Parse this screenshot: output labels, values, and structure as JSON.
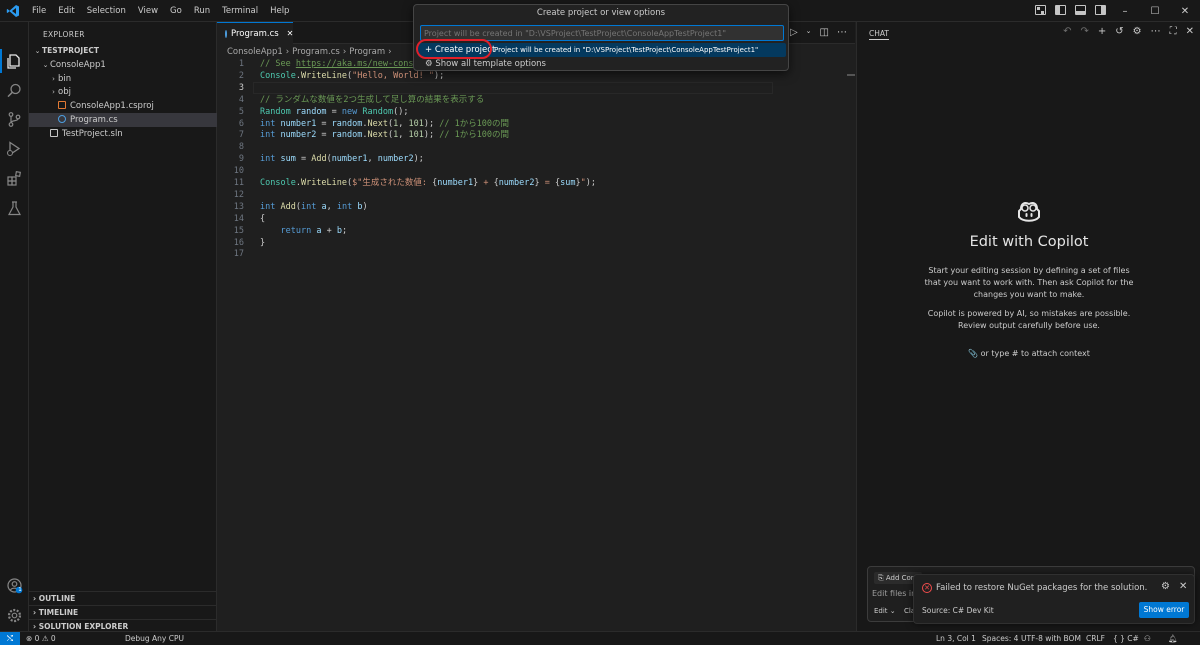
{
  "menu": [
    "File",
    "Edit",
    "Selection",
    "View",
    "Go",
    "Run",
    "Terminal",
    "Help"
  ],
  "window": {
    "minimize": "–",
    "maximize": "☐",
    "close": "✕"
  },
  "sidebar": {
    "title": "EXPLORER",
    "tree": [
      {
        "label": "TESTPROJECT",
        "indent": 0,
        "chevron": "⌄",
        "bold": true
      },
      {
        "label": "ConsoleApp1",
        "indent": 1,
        "chevron": "⌄"
      },
      {
        "label": "bin",
        "indent": 2,
        "chevron": "›"
      },
      {
        "label": "obj",
        "indent": 2,
        "chevron": "›"
      },
      {
        "label": "ConsoleApp1.csproj",
        "indent": 2,
        "chevron": "",
        "icon": "csproj-file-icon",
        "icon_color": "#e37933"
      },
      {
        "label": "Program.cs",
        "indent": 2,
        "chevron": "",
        "icon": "csharp-file-icon",
        "icon_color": "#4d9ee0",
        "selected": true
      },
      {
        "label": "TestProject.sln",
        "indent": 1,
        "chevron": "",
        "icon": "sln-file-icon",
        "icon_color": "#c5c5c5"
      }
    ],
    "sections": [
      "OUTLINE",
      "TIMELINE",
      "SOLUTION EXPLORER"
    ]
  },
  "editor": {
    "tab": {
      "label": "Program.cs",
      "close": "✕"
    },
    "breadcrumb": [
      "ConsoleApp1",
      "›",
      "Program.cs",
      "›",
      "Program",
      "›"
    ],
    "lines": [
      {
        "n": "1",
        "tokens": [
          [
            "cm",
            "// See "
          ],
          [
            "lnk",
            "https://aka.ms/new-consol"
          ]
        ]
      },
      {
        "n": "2",
        "tokens": [
          [
            "cls",
            "Console"
          ],
          [
            "",
            "."
          ],
          [
            "fn",
            "WriteLine"
          ],
          [
            "",
            "("
          ],
          [
            "str",
            "\"Hello, World! \""
          ],
          [
            "",
            ");"
          ]
        ]
      },
      {
        "n": "3",
        "tokens": [],
        "current": true
      },
      {
        "n": "4",
        "tokens": [
          [
            "cm",
            "// ランダムな数値を2つ生成して足し算の結果を表示する"
          ]
        ]
      },
      {
        "n": "5",
        "tokens": [
          [
            "cls",
            "Random"
          ],
          [
            "",
            " "
          ],
          [
            "var",
            "random"
          ],
          [
            "",
            " = "
          ],
          [
            "kw",
            "new"
          ],
          [
            "",
            " "
          ],
          [
            "cls",
            "Random"
          ],
          [
            "",
            "();"
          ]
        ]
      },
      {
        "n": "6",
        "tokens": [
          [
            "kw",
            "int"
          ],
          [
            "",
            " "
          ],
          [
            "var",
            "number1"
          ],
          [
            "",
            " = "
          ],
          [
            "var",
            "random"
          ],
          [
            "",
            "."
          ],
          [
            "fn",
            "Next"
          ],
          [
            "",
            "("
          ],
          [
            "num",
            "1"
          ],
          [
            "",
            ", "
          ],
          [
            "num",
            "101"
          ],
          [
            "",
            "); "
          ],
          [
            "cm",
            "// 1から100の間"
          ]
        ]
      },
      {
        "n": "7",
        "tokens": [
          [
            "kw",
            "int"
          ],
          [
            "",
            " "
          ],
          [
            "var",
            "number2"
          ],
          [
            "",
            " = "
          ],
          [
            "var",
            "random"
          ],
          [
            "",
            "."
          ],
          [
            "fn",
            "Next"
          ],
          [
            "",
            "("
          ],
          [
            "num",
            "1"
          ],
          [
            "",
            ", "
          ],
          [
            "num",
            "101"
          ],
          [
            "",
            "); "
          ],
          [
            "cm",
            "// 1から100の間"
          ]
        ]
      },
      {
        "n": "8",
        "tokens": []
      },
      {
        "n": "9",
        "tokens": [
          [
            "kw",
            "int"
          ],
          [
            "",
            " "
          ],
          [
            "var",
            "sum"
          ],
          [
            "",
            " = "
          ],
          [
            "fn",
            "Add"
          ],
          [
            "",
            "("
          ],
          [
            "var",
            "number1"
          ],
          [
            "",
            ", "
          ],
          [
            "var",
            "number2"
          ],
          [
            "",
            ");"
          ]
        ]
      },
      {
        "n": "10",
        "tokens": []
      },
      {
        "n": "11",
        "tokens": [
          [
            "cls",
            "Console"
          ],
          [
            "",
            "."
          ],
          [
            "fn",
            "WriteLine"
          ],
          [
            "",
            "("
          ],
          [
            "str",
            "$\"生成された数値: "
          ],
          [
            "",
            "{"
          ],
          [
            "var",
            "number1"
          ],
          [
            "",
            "}"
          ],
          [
            "str",
            " + "
          ],
          [
            "",
            "{"
          ],
          [
            "var",
            "number2"
          ],
          [
            "",
            "}"
          ],
          [
            "str",
            " = "
          ],
          [
            "",
            "{"
          ],
          [
            "var",
            "sum"
          ],
          [
            "",
            "}"
          ],
          [
            "str",
            "\""
          ],
          [
            "",
            ");"
          ]
        ]
      },
      {
        "n": "12",
        "tokens": []
      },
      {
        "n": "13",
        "tokens": [
          [
            "kw",
            "int"
          ],
          [
            "",
            " "
          ],
          [
            "fn",
            "Add"
          ],
          [
            "",
            "("
          ],
          [
            "kw",
            "int"
          ],
          [
            "",
            " "
          ],
          [
            "var",
            "a"
          ],
          [
            "",
            ", "
          ],
          [
            "kw",
            "int"
          ],
          [
            "",
            " "
          ],
          [
            "var",
            "b"
          ],
          [
            "",
            ")"
          ]
        ]
      },
      {
        "n": "14",
        "tokens": [
          [
            "",
            "{"
          ]
        ]
      },
      {
        "n": "15",
        "tokens": [
          [
            "",
            "    "
          ],
          [
            "kw",
            "return"
          ],
          [
            "",
            " "
          ],
          [
            "var",
            "a"
          ],
          [
            "",
            " + "
          ],
          [
            "var",
            "b"
          ],
          [
            "",
            ";"
          ]
        ]
      },
      {
        "n": "16",
        "tokens": [
          [
            "",
            "}"
          ]
        ]
      },
      {
        "n": "17",
        "tokens": []
      }
    ]
  },
  "quickpick": {
    "title": "Create project or view options",
    "placeholder": "Project will be created in \"D:\\VSProject\\TestProject\\ConsoleAppTestProject1\"",
    "items": [
      {
        "icon": "+",
        "label": "Create project",
        "description": "Project will be created in \"D:\\VSProject\\TestProject\\ConsoleAppTestProject1\""
      },
      {
        "icon": "⚙",
        "label": "Show all template options",
        "description": ""
      }
    ]
  },
  "chat": {
    "title": "CHAT",
    "heading": "Edit with Copilot",
    "desc1": "Start your editing session by defining a set of files that you want to work with. Then ask Copilot for the changes you want to make.",
    "desc2": "Copilot is powered by AI, so mistakes are possible. Review output carefully before use.",
    "attach": "or type # to attach context",
    "add_context": "Add Cont",
    "input_placeholder": "Edit files in y",
    "edit_label": "Edit",
    "cla_label": "Cla"
  },
  "notification": {
    "message": "Failed to restore NuGet packages for the solution.",
    "source": "Source: C# Dev Kit",
    "button": "Show error"
  },
  "status": {
    "problems": "⊗ 0 ⚠ 0",
    "debug": "Debug Any CPU",
    "position": "Ln 3, Col 1",
    "spaces": "Spaces: 4",
    "encoding": "UTF-8 with BOM",
    "eol": "CRLF",
    "language": "{ } C#"
  },
  "badge": "1"
}
